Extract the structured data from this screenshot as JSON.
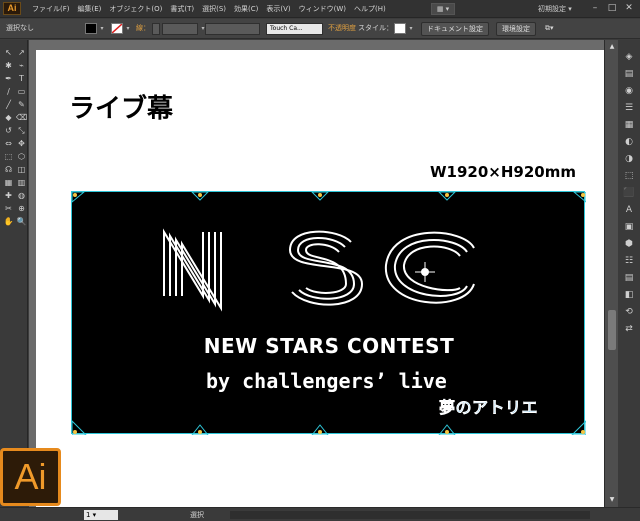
{
  "app": {
    "logo": "Ai"
  },
  "menu": [
    "ファイル(F)",
    "編集(E)",
    "オブジェクト(O)",
    "書式(T)",
    "選択(S)",
    "効果(C)",
    "表示(V)",
    "ウィンドウ(W)",
    "ヘルプ(H)"
  ],
  "workspace": {
    "label": "初期設定 ▾"
  },
  "window_controls": {
    "minimize": "–",
    "maximize": "□",
    "close": "✕"
  },
  "controlbar": {
    "selection_label": "選択なし",
    "stroke_label": "線：",
    "brush_label": "Touch Ca...",
    "opacity_label": "不透明度",
    "style_label": "スタイル：",
    "doc_setup_label": "ドキュメント設定",
    "prefs_label": "環境設定"
  },
  "tools": [
    "↖",
    "↗",
    "✱",
    "⌁",
    "✒",
    "T",
    "∕",
    "▭",
    "╱",
    "✎",
    "◆",
    "⌫",
    "↺",
    "⤡",
    "⇔",
    "✥",
    "⬚",
    "⬡",
    "☊",
    "◫",
    "▦",
    "▥",
    "✚",
    "◍",
    "✂",
    "⊕",
    "✋",
    "🔍"
  ],
  "dock": [
    "◈",
    "▤",
    "◉",
    "☰",
    "▦",
    "◐",
    "◑",
    "⬚",
    "⬛",
    "A",
    "▣",
    "⬢",
    "☷",
    "▤",
    "◧",
    "⟲",
    "⇄"
  ],
  "document": {
    "title": "ライブ幕",
    "size_label": "W1920×H920mm",
    "banner": {
      "headline": "NSC",
      "subtitle": "NEW STARS  CONTEST",
      "tagline": "by challengers’ live",
      "logo": "夢のアトリエ",
      "colors": {
        "background": "#000000",
        "text": "#ffffff",
        "logo": "#2a9ce0",
        "guide": "#2ec6d8",
        "anchor": "#f5c542"
      }
    }
  },
  "statusbar": {
    "zoom": "1 ▾",
    "status": "選択"
  },
  "icons": {
    "scroll_up": "▲",
    "scroll_down": "▼",
    "ws_switch": "▦ ▾"
  }
}
